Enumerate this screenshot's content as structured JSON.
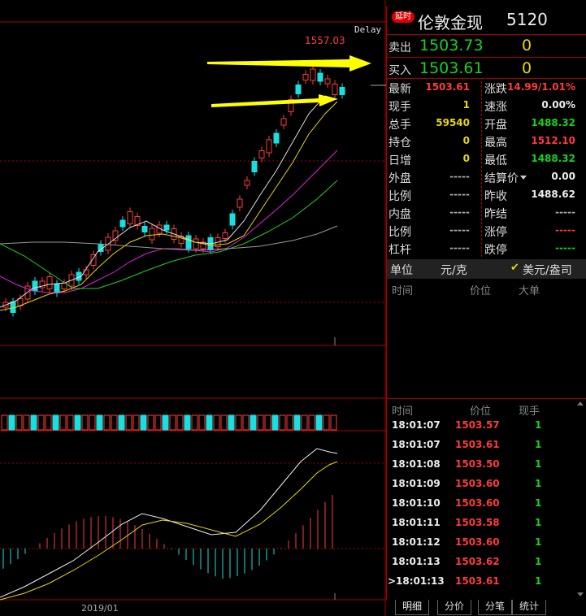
{
  "chart": {
    "delay_label": "Delay",
    "high_label": "1557.03",
    "date_label": "2019/01"
  },
  "panel": {
    "badge": "延时",
    "title": "伦敦金现",
    "code": "5120",
    "sell": {
      "label": "卖出",
      "price": "1503.73",
      "vol": "0"
    },
    "buy": {
      "label": "买入",
      "price": "1503.61",
      "vol": "0"
    },
    "stats_left": [
      {
        "label": "最新",
        "value": "1503.61",
        "color": "red"
      },
      {
        "label": "现手",
        "value": "1",
        "color": "yel"
      },
      {
        "label": "总手",
        "value": "59540",
        "color": "yel"
      },
      {
        "label": "持仓",
        "value": "0",
        "color": "yel"
      },
      {
        "label": "日增",
        "value": "0",
        "color": "yel"
      },
      {
        "label": "外盘",
        "value": "-----",
        "color": "gry"
      },
      {
        "label": "比例",
        "value": "-----",
        "color": "gry"
      },
      {
        "label": "内盘",
        "value": "-----",
        "color": "gry"
      },
      {
        "label": "比例",
        "value": "-----",
        "color": "gry"
      },
      {
        "label": "杠杆",
        "value": "-----",
        "color": "gry"
      }
    ],
    "stats_right": [
      {
        "label": "涨跌",
        "value": "14.99/1.01%",
        "color": "red"
      },
      {
        "label": "速涨",
        "value": "0.00%",
        "color": "wht"
      },
      {
        "label": "开盘",
        "value": "1488.32",
        "color": "grn"
      },
      {
        "label": "最高",
        "value": "1512.10",
        "color": "red"
      },
      {
        "label": "最低",
        "value": "1488.32",
        "color": "grn"
      },
      {
        "label": "结算价",
        "value": "0.00",
        "color": "wht"
      },
      {
        "label": "昨收",
        "value": "1488.62",
        "color": "wht"
      },
      {
        "label": "昨结",
        "value": "-----",
        "color": "gry"
      },
      {
        "label": "涨停",
        "value": "-----",
        "color": "red"
      },
      {
        "label": "跌停",
        "value": "-----",
        "color": "grn"
      }
    ],
    "unit": {
      "label": "单位",
      "opt1": "元/克",
      "check": "✔",
      "opt2": "美元/盎司"
    },
    "big_header": {
      "time": "时间",
      "price": "价位",
      "vol": "大单"
    },
    "tick_header": {
      "time": "时间",
      "price": "价位",
      "vol": "现手"
    },
    "ticks": [
      {
        "time": "18:01:07",
        "price": "1503.57",
        "vol": "1"
      },
      {
        "time": "18:01:07",
        "price": "1503.61",
        "vol": "1"
      },
      {
        "time": "18:01:08",
        "price": "1503.50",
        "vol": "1"
      },
      {
        "time": "18:01:09",
        "price": "1503.60",
        "vol": "1"
      },
      {
        "time": "18:01:10",
        "price": "1503.60",
        "vol": "1"
      },
      {
        "time": "18:01:11",
        "price": "1503.58",
        "vol": "1"
      },
      {
        "time": "18:01:12",
        "price": "1503.60",
        "vol": "1"
      },
      {
        "time": "18:01:13",
        "price": "1503.62",
        "vol": "1"
      },
      {
        "time": ">18:01:13",
        "price": "1503.61",
        "vol": "1"
      }
    ],
    "tabs": [
      "明细",
      "分价",
      "分笔",
      "统计"
    ]
  },
  "colors": {
    "up": "#ff3b3b",
    "down": "#19e0e0",
    "arrow": "#ffff00",
    "grid": "#a00000"
  }
}
